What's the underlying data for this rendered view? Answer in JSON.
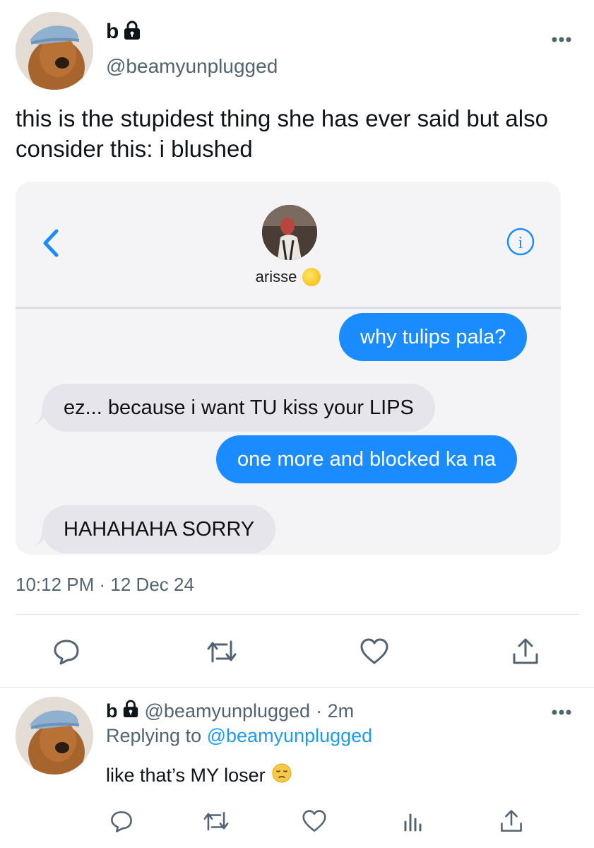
{
  "tweet": {
    "display_name": "b",
    "handle": "@beamyunplugged",
    "text": "this is the stupidest thing she has ever said but also consider this: i blushed",
    "timestamp": "10:12 PM · 12 Dec 24"
  },
  "screenshot": {
    "contact_name": "arisse",
    "messages": [
      {
        "from": "me",
        "text": "why tulips pala?"
      },
      {
        "from": "them",
        "text": "ez... because i want TU kiss your LIPS"
      },
      {
        "from": "me",
        "text": "one more and blocked ka na"
      },
      {
        "from": "them",
        "text": "HAHAHAHA SORRY"
      }
    ],
    "colors": {
      "outgoing": "#1a8cff",
      "incoming": "#e6e5eb",
      "accent": "#1a8cff"
    }
  },
  "actions": [
    "reply-icon",
    "retweet-icon",
    "like-icon",
    "share-icon"
  ],
  "reply": {
    "display_name": "b",
    "handle": "@beamyunplugged",
    "time": "· 2m",
    "replying_prefix": "Replying to",
    "replying_to": "@beamyunplugged",
    "text": "like that’s MY loser",
    "actions": [
      "reply-icon",
      "retweet-icon",
      "like-icon",
      "analytics-icon",
      "share-icon"
    ]
  },
  "colors": {
    "text": "#0f1419",
    "secondary": "#536471",
    "link": "#1d9bf0",
    "divider": "#e1e6ea"
  }
}
